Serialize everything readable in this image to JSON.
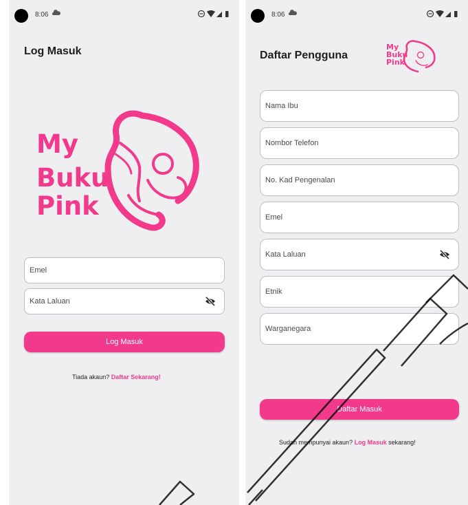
{
  "colors": {
    "brand_pink": "#f23a8c",
    "screen_background": "#efeef0",
    "field_border": "#bdbdbd"
  },
  "status_bar": {
    "time": "8:06"
  },
  "login_screen": {
    "title": "Log Masuk",
    "logo_lines": [
      "My",
      "Buku",
      "Pink"
    ],
    "email_placeholder": "Emel",
    "password_placeholder": "Kata Laluan",
    "password_toggle_icon": "eye-off-icon",
    "submit_label": "Log Masuk",
    "footer_prefix": "Tiada akaun?",
    "footer_link": "Daftar Sekarang!"
  },
  "register_screen": {
    "title": "Daftar Pengguna",
    "logo_lines": [
      "My",
      "Buku",
      "Pink"
    ],
    "fields": [
      {
        "placeholder": "Nama Ibu"
      },
      {
        "placeholder": "Nombor Telefon"
      },
      {
        "placeholder": "No. Kad Pengenalan"
      },
      {
        "placeholder": "Emel"
      },
      {
        "placeholder": "Kata Laluan",
        "password_toggle_icon": "eye-off-icon"
      },
      {
        "placeholder": "Etnik"
      },
      {
        "placeholder": "Warganegara"
      }
    ],
    "submit_label": "Daftar Masuk",
    "footer_prefix": "Sudah mempunyai akaun?",
    "footer_link": "Log Masuk",
    "footer_suffix": "sekarang!"
  }
}
